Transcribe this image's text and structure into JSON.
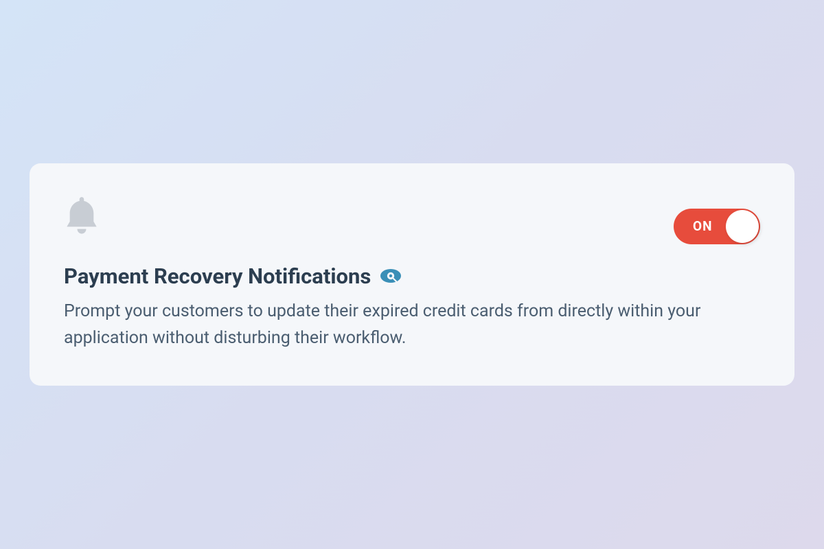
{
  "card": {
    "title": "Payment Recovery Notifications",
    "description": "Prompt your customers to update their expired credit cards from directly within your application without disturbing their workflow.",
    "toggle": {
      "state": "ON"
    }
  }
}
